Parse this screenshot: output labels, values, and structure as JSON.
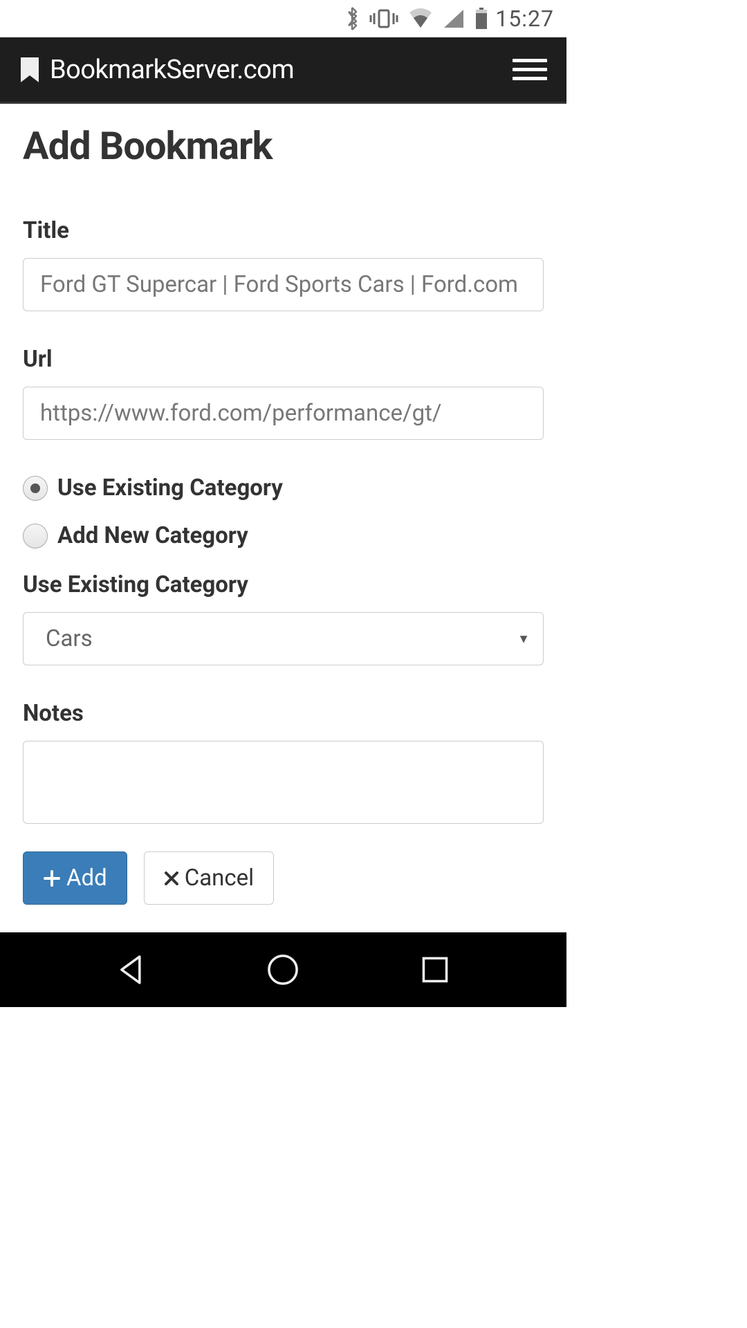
{
  "status": {
    "time": "15:27"
  },
  "header": {
    "title": "BookmarkServer.com"
  },
  "page": {
    "title": "Add Bookmark"
  },
  "form": {
    "title_label": "Title",
    "title_value": "Ford GT Supercar | Ford Sports Cars | Ford.com",
    "url_label": "Url",
    "url_value": "https://www.ford.com/performance/gt/",
    "radio_existing": "Use Existing Category",
    "radio_new": "Add New Category",
    "category_label": "Use Existing Category",
    "category_value": "Cars",
    "notes_label": "Notes",
    "notes_value": "",
    "add_label": "Add",
    "cancel_label": "Cancel"
  }
}
